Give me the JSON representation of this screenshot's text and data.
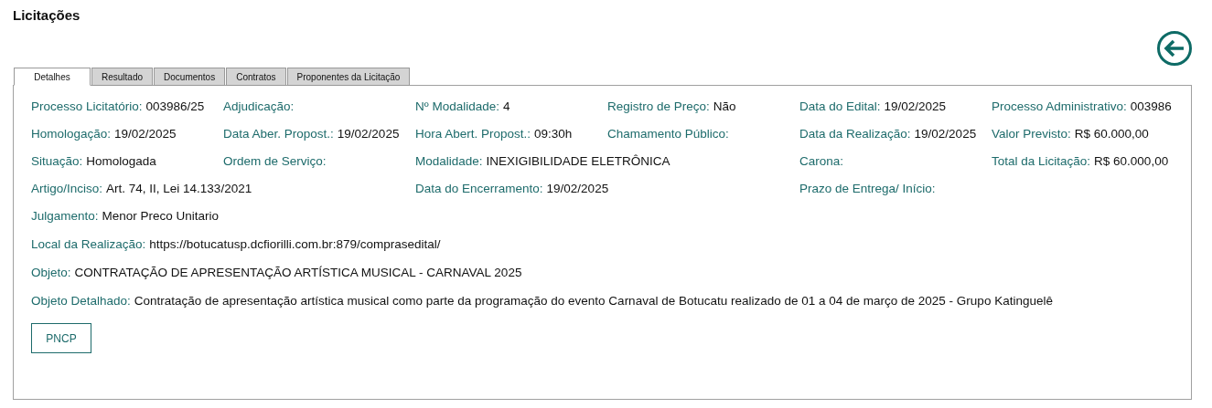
{
  "page": {
    "title": "Licitações"
  },
  "tabs": [
    {
      "label": "Detalhes",
      "selected": true
    },
    {
      "label": "Resultado",
      "selected": false
    },
    {
      "label": "Documentos",
      "selected": false
    },
    {
      "label": "Contratos",
      "selected": false
    },
    {
      "label": "Proponentes da Licitação",
      "selected": false
    }
  ],
  "grid_rows": [
    [
      {
        "label": "Processo Licitatório:",
        "value": "003986/25"
      },
      {
        "label": "Adjudicação:"
      },
      {
        "label": "Nº Modalidade:",
        "value": "4"
      },
      {
        "label": "Registro de Preço:",
        "value": "Não"
      },
      {
        "label": "Data do Edital:",
        "value": "19/02/2025"
      },
      {
        "label": "Processo Administrativo:",
        "value": "003986"
      }
    ],
    [
      {
        "label": "Homologação:",
        "value": "19/02/2025"
      },
      {
        "label": "Data Aber. Propost.:",
        "value": "19/02/2025"
      },
      {
        "label": "Hora Abert. Propost.:",
        "value": "09:30h"
      },
      {
        "label": "Chamamento Público:"
      },
      {
        "label": "Data da Realização:",
        "value": "19/02/2025"
      },
      {
        "label": "Valor Previsto:",
        "value": "R$ 60.000,00"
      }
    ],
    [
      {
        "label": "Situação:",
        "value": "Homologada"
      },
      {
        "label": "Ordem de Serviço:"
      },
      {
        "label": "Modalidade:",
        "value": "INEXIGIBILIDADE ELETRÔNICA"
      },
      {
        "label": "Carona:"
      },
      {
        "label": "Total da Licitação:",
        "value": "R$ 60.000,00"
      }
    ],
    [
      {
        "label": "Artigo/Inciso:",
        "value": "Art. 74, II, Lei 14.133/2021"
      },
      {
        "label": "Data do Encerramento:",
        "value": "19/02/2025"
      },
      {
        "label": "Prazo de Entrega/ Início:"
      }
    ]
  ],
  "full_rows": [
    {
      "label": "Julgamento:",
      "value": "Menor Preco Unitario"
    },
    {
      "label": "Local da Realização:",
      "value": "https://botucatusp.dcfiorilli.com.br:879/comprasedital/"
    },
    {
      "label": "Objeto:",
      "value": "CONTRATAÇÃO DE APRESENTAÇÃO ARTÍSTICA MUSICAL - CARNAVAL 2025"
    },
    {
      "label": "Objeto Detalhado:",
      "value": "Contratação de apresentação artística musical como parte da programação do evento Carnaval de Botucatu realizado de 01 a 04 de março de 2025 - Grupo Katinguelê"
    }
  ],
  "buttons": [
    "PNCP"
  ]
}
